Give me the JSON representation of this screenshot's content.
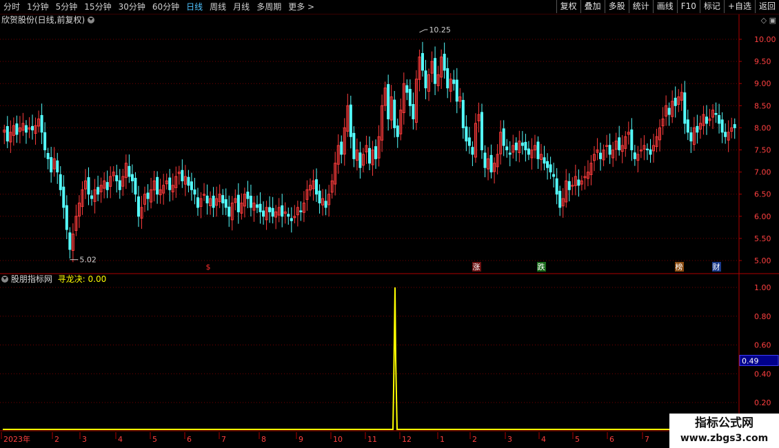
{
  "toolbar": {
    "periods": [
      "分时",
      "1分钟",
      "5分钟",
      "15分钟",
      "30分钟",
      "60分钟",
      "日线",
      "周线",
      "月线",
      "多周期",
      "更多 >"
    ],
    "active_period": "日线",
    "actions": [
      "复权",
      "叠加",
      "多股",
      "统计",
      "画线",
      "F10",
      "标记",
      "+自选",
      "返回"
    ]
  },
  "stock": {
    "title": "欣贺股份(日线,前复权)"
  },
  "indicator": {
    "source": "股朋指标网",
    "name_value": "寻龙决: 0.00",
    "current_marker": "0.49"
  },
  "price_axis": {
    "ticks": [
      "10.00",
      "9.50",
      "9.00",
      "8.50",
      "8.00",
      "7.50",
      "7.00",
      "6.50",
      "6.00",
      "5.50",
      "5.00"
    ]
  },
  "indicator_axis": {
    "ticks": [
      "1.00",
      "0.80",
      "0.60",
      "0.40",
      "0.20"
    ]
  },
  "annotations": {
    "high_label": "10.25",
    "low_label": "5.02"
  },
  "event_markers": [
    "$",
    "涨",
    "跌",
    "榜",
    "财"
  ],
  "time_axis": {
    "labels": [
      "2023年",
      "2",
      "3",
      "4",
      "5",
      "6",
      "7",
      "8",
      "9",
      "10",
      "11",
      "12",
      "1",
      "2",
      "3",
      "4",
      "5",
      "6",
      "7"
    ]
  },
  "watermark": {
    "title": "指标公式网",
    "url": "www.zbgs3.com"
  },
  "colors": {
    "up": "#ff3c3c",
    "down": "#54ffff",
    "grid": "#7a0000",
    "indicator_line": "#ffff00",
    "axis_text": "#ff4040"
  },
  "chart_data": {
    "type": "candlestick",
    "ylim": [
      4.85,
      10.25
    ],
    "indicator_ylim": [
      0,
      1.0
    ],
    "closes": [
      7.95,
      7.7,
      7.9,
      8.05,
      7.85,
      8.0,
      8.1,
      7.9,
      8.0,
      7.95,
      8.05,
      8.2,
      7.9,
      7.5,
      7.3,
      7.0,
      7.3,
      7.0,
      6.6,
      6.2,
      5.7,
      5.25,
      5.6,
      6.0,
      6.3,
      6.6,
      6.8,
      6.5,
      6.4,
      6.6,
      6.5,
      6.7,
      6.8,
      6.6,
      6.9,
      7.0,
      6.8,
      6.6,
      6.9,
      7.2,
      6.9,
      6.8,
      6.5,
      6.0,
      6.2,
      6.5,
      6.4,
      6.6,
      6.8,
      6.5,
      6.6,
      6.7,
      6.8,
      6.6,
      6.7,
      6.9,
      7.0,
      6.8,
      6.9,
      6.7,
      6.6,
      6.5,
      6.2,
      6.4,
      6.5,
      6.3,
      6.4,
      6.2,
      6.4,
      6.5,
      6.3,
      6.2,
      6.0,
      6.3,
      6.4,
      6.1,
      6.3,
      6.5,
      6.4,
      6.2,
      6.3,
      6.2,
      6.1,
      6.0,
      6.2,
      6.1,
      6.0,
      6.1,
      6.2,
      6.0,
      6.1,
      6.0,
      5.9,
      6.0,
      6.2,
      6.1,
      6.3,
      6.6,
      6.7,
      6.8,
      6.5,
      6.3,
      6.4,
      6.2,
      6.5,
      6.8,
      7.2,
      7.6,
      7.4,
      8.0,
      8.5,
      7.8,
      7.3,
      7.5,
      7.1,
      7.4,
      7.6,
      7.2,
      7.5,
      7.3,
      7.8,
      8.5,
      8.9,
      8.2,
      8.7,
      8.0,
      7.8,
      8.4,
      9.0,
      8.8,
      8.5,
      8.2,
      9.1,
      9.6,
      9.3,
      8.9,
      9.2,
      9.5,
      9.0,
      9.2,
      9.6,
      9.3,
      8.9,
      9.1,
      9.0,
      8.6,
      8.7,
      8.0,
      7.7,
      7.6,
      7.4,
      8.1,
      8.3,
      7.5,
      7.1,
      7.3,
      7.0,
      7.2,
      7.4,
      7.9,
      7.6,
      7.5,
      7.4,
      7.6,
      7.5,
      7.7,
      7.6,
      7.5,
      7.4,
      7.5,
      7.6,
      7.3,
      7.4,
      7.2,
      7.1,
      7.0,
      6.9,
      6.5,
      6.2,
      6.4,
      6.8,
      6.6,
      6.7,
      6.9,
      6.7,
      6.8,
      6.9,
      7.0,
      7.2,
      7.4,
      7.5,
      7.3,
      7.5,
      7.6,
      7.4,
      7.5,
      7.7,
      7.5,
      7.6,
      7.8,
      7.9,
      7.5,
      7.3,
      7.4,
      7.5,
      7.6,
      7.5,
      7.4,
      7.6,
      7.8,
      8.0,
      8.2,
      8.5,
      8.3,
      8.6,
      8.5,
      8.7,
      8.8,
      8.1,
      7.9,
      7.7,
      8.0,
      7.9,
      8.1,
      8.3,
      8.1,
      8.2,
      8.4,
      8.3,
      8.1,
      7.9,
      7.8,
      7.9,
      8.0,
      8.0
    ],
    "indicator_values_nonzero": [
      {
        "index": 0.5,
        "value": 1.0
      }
    ]
  }
}
